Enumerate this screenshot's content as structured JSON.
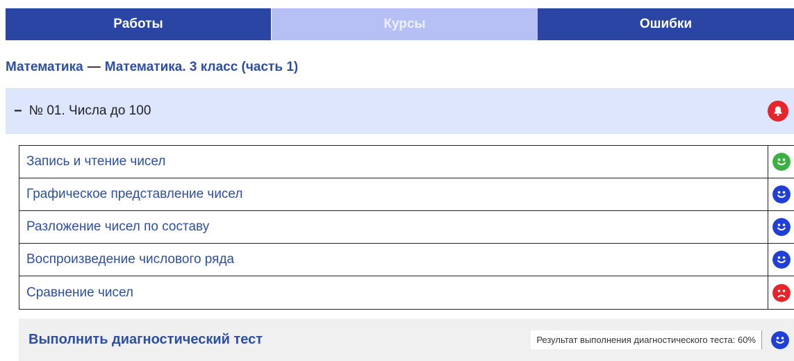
{
  "tabs": [
    {
      "label": "Работы",
      "active": false
    },
    {
      "label": "Курсы",
      "active": true
    },
    {
      "label": "Ошибки",
      "active": false
    }
  ],
  "breadcrumb": {
    "subject": "Математика",
    "separator": "—",
    "course": "Математика. 3 класс (часть 1)"
  },
  "section": {
    "toggle": "−",
    "title": "№ 01. Числа до 100",
    "alert_icon": "bell-icon",
    "alert_color": "#e5242b"
  },
  "topics": [
    {
      "label": "Запись и чтение чисел",
      "status": "happy",
      "color": "#3cb043"
    },
    {
      "label": "Графическое представление чисел",
      "status": "happy",
      "color": "#1f3fd6"
    },
    {
      "label": "Разложение чисел по составу",
      "status": "happy",
      "color": "#1f3fd6"
    },
    {
      "label": "Воспроизведение числового ряда",
      "status": "happy",
      "color": "#1f3fd6"
    },
    {
      "label": "Сравнение чисел",
      "status": "sad",
      "color": "#e5242b"
    }
  ],
  "diagnostic": {
    "button_label": "Выполнить диагностический тест",
    "result_text": "Результат выполнения диагностического теста: 60%",
    "status": "happy",
    "color": "#1f3fd6"
  },
  "colors": {
    "tab_active_bg": "#b6c0f5",
    "tab_bg": "#2a45a3",
    "link": "#2c4fa3",
    "section_bg": "#dde6fc"
  }
}
